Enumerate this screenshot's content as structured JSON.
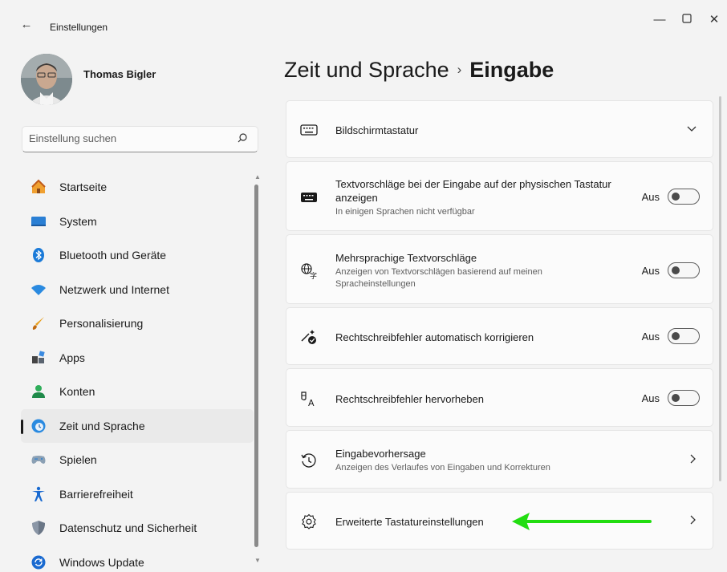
{
  "window": {
    "app_title": "Einstellungen",
    "back_icon": "back-arrow-icon",
    "controls": [
      "minimize-icon",
      "maximize-icon",
      "close-icon"
    ]
  },
  "user": {
    "name": "Thomas Bigler"
  },
  "search": {
    "placeholder": "Einstellung suchen",
    "icon": "search-icon"
  },
  "sidebar": {
    "items": [
      {
        "label": "Startseite",
        "icon": "home-icon",
        "active": false
      },
      {
        "label": "System",
        "icon": "monitor-icon",
        "active": false
      },
      {
        "label": "Bluetooth und Geräte",
        "icon": "bluetooth-icon",
        "active": false
      },
      {
        "label": "Netzwerk und Internet",
        "icon": "wifi-icon",
        "active": false
      },
      {
        "label": "Personalisierung",
        "icon": "brush-icon",
        "active": false
      },
      {
        "label": "Apps",
        "icon": "apps-icon",
        "active": false
      },
      {
        "label": "Konten",
        "icon": "person-icon",
        "active": false
      },
      {
        "label": "Zeit und Sprache",
        "icon": "globe-clock-icon",
        "active": true
      },
      {
        "label": "Spielen",
        "icon": "gamepad-icon",
        "active": false
      },
      {
        "label": "Barrierefreiheit",
        "icon": "accessibility-icon",
        "active": false
      },
      {
        "label": "Datenschutz und Sicherheit",
        "icon": "shield-icon",
        "active": false
      },
      {
        "label": "Windows Update",
        "icon": "update-icon",
        "active": false
      }
    ]
  },
  "header": {
    "parent": "Zeit und Sprache",
    "separator": "›",
    "current": "Eingabe"
  },
  "settings": [
    {
      "title": "Bildschirmtastatur",
      "subtitle": "",
      "icon": "keyboard-icon",
      "control": "expand"
    },
    {
      "title": "Textvorschläge bei der Eingabe auf der physischen Tastatur anzeigen",
      "subtitle": "In einigen Sprachen nicht verfügbar",
      "icon": "keyboard-filled-icon",
      "control": "toggle",
      "state": "Aus"
    },
    {
      "title": "Mehrsprachige Textvorschläge",
      "subtitle": "Anzeigen von Textvorschlägen basierend auf meinen Spracheinstellungen",
      "icon": "language-icon",
      "control": "toggle",
      "state": "Aus"
    },
    {
      "title": "Rechtschreibfehler automatisch korrigieren",
      "subtitle": "",
      "icon": "autocorrect-icon",
      "control": "toggle",
      "state": "Aus"
    },
    {
      "title": "Rechtschreibfehler hervorheben",
      "subtitle": "",
      "icon": "spellcheck-icon",
      "control": "toggle",
      "state": "Aus"
    },
    {
      "title": "Eingabevorhersage",
      "subtitle": "Anzeigen des Verlaufes von Eingaben und Korrekturen",
      "icon": "history-icon",
      "control": "link"
    },
    {
      "title": "Erweiterte Tastatureinstellungen",
      "subtitle": "",
      "icon": "gear-icon",
      "control": "link"
    }
  ],
  "colors": {
    "accent_annotation": "#22dd11",
    "background": "#f3f3f3",
    "card": "#fbfbfb"
  }
}
